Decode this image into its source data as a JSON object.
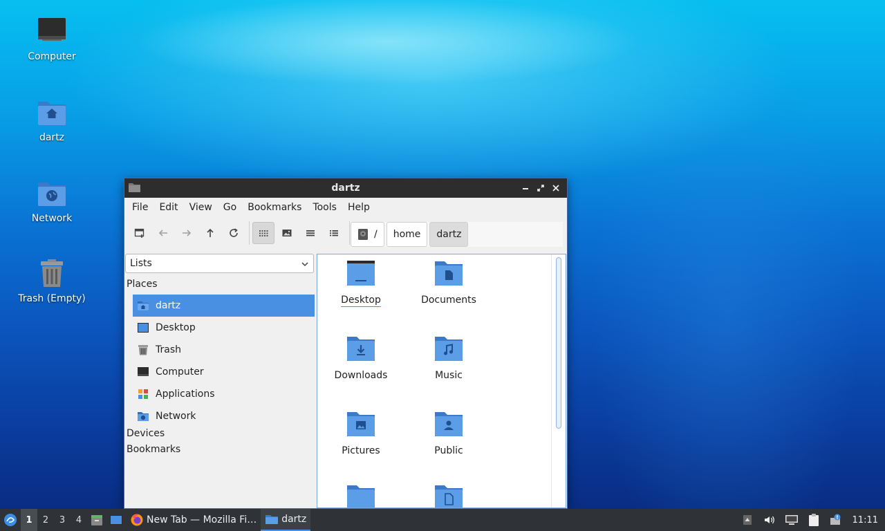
{
  "desktop": {
    "icons": [
      {
        "label": "Computer"
      },
      {
        "label": "dartz"
      },
      {
        "label": "Network"
      },
      {
        "label": "Trash (Empty)"
      }
    ]
  },
  "window": {
    "title": "dartz",
    "menu": [
      "File",
      "Edit",
      "View",
      "Go",
      "Bookmarks",
      "Tools",
      "Help"
    ],
    "path": {
      "root": "/",
      "crumbs": [
        "home",
        "dartz"
      ]
    },
    "side_pane": {
      "mode": "Lists",
      "places_heading": "Places",
      "places": [
        "dartz",
        "Desktop",
        "Trash",
        "Computer",
        "Applications",
        "Network"
      ],
      "devices_heading": "Devices",
      "bookmarks_heading": "Bookmarks"
    },
    "files": [
      "Desktop",
      "Documents",
      "Downloads",
      "Music",
      "Pictures",
      "Public"
    ]
  },
  "taskbar": {
    "workspaces": [
      "1",
      "2",
      "3",
      "4"
    ],
    "tasks": [
      {
        "label": "New Tab — Mozilla Fi…",
        "icon": "firefox-icon"
      },
      {
        "label": "dartz",
        "icon": "folder-icon"
      }
    ],
    "clock": "11:11"
  },
  "colors": {
    "folder": "#4a90e2",
    "selection": "#4a90e2",
    "titlebar": "#2d2d2d",
    "taskbar": "#2f3337"
  }
}
